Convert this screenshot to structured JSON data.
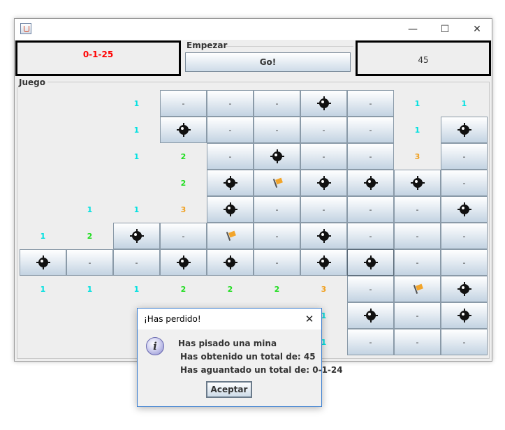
{
  "window": {
    "title": "",
    "controls": {
      "minimize": "—",
      "maximize": "☐",
      "close": "✕"
    }
  },
  "header": {
    "timer": "0-1-25",
    "start_legend": "Empezar",
    "go_label": "Go!",
    "score": "45"
  },
  "game": {
    "legend": "Juego",
    "grid": [
      [
        "",
        "",
        "1",
        "-",
        "-",
        "-",
        "M",
        "-",
        "1",
        "1"
      ],
      [
        "",
        "",
        "1",
        "M",
        "-",
        "-",
        "-",
        "-",
        "1",
        "M"
      ],
      [
        "",
        "",
        "1",
        "2",
        "-",
        "M",
        "-",
        "-",
        "3",
        "-"
      ],
      [
        "",
        "",
        "",
        "2",
        "M",
        "F",
        "M",
        "M",
        "M",
        "-"
      ],
      [
        "",
        "1",
        "1",
        "3",
        "M",
        "-",
        "-",
        "-",
        "-",
        "M"
      ],
      [
        "1",
        "2",
        "M",
        "-",
        "F",
        "-",
        "M",
        "-",
        "-",
        "-"
      ],
      [
        "M",
        "-",
        "-",
        "M",
        "M",
        "-",
        "M",
        "M*",
        "-",
        "-"
      ],
      [
        "1",
        "1",
        "1",
        "2",
        "2",
        "2",
        "3",
        "-",
        "F",
        "M"
      ],
      [
        "",
        "",
        "",
        "",
        "",
        "",
        "1",
        "M",
        "-",
        "M"
      ],
      [
        "",
        "",
        "",
        "",
        "",
        "",
        "1",
        "-",
        "-",
        "-"
      ]
    ]
  },
  "dialog": {
    "title": "¡Has perdido!",
    "close": "✕",
    "icon": "i",
    "line1": "Has pisado una mina",
    "line2": "Has obtenido un total de: 45",
    "line3": "Has aguantado un total de: 0-1-24",
    "ok_label": "Aceptar"
  }
}
